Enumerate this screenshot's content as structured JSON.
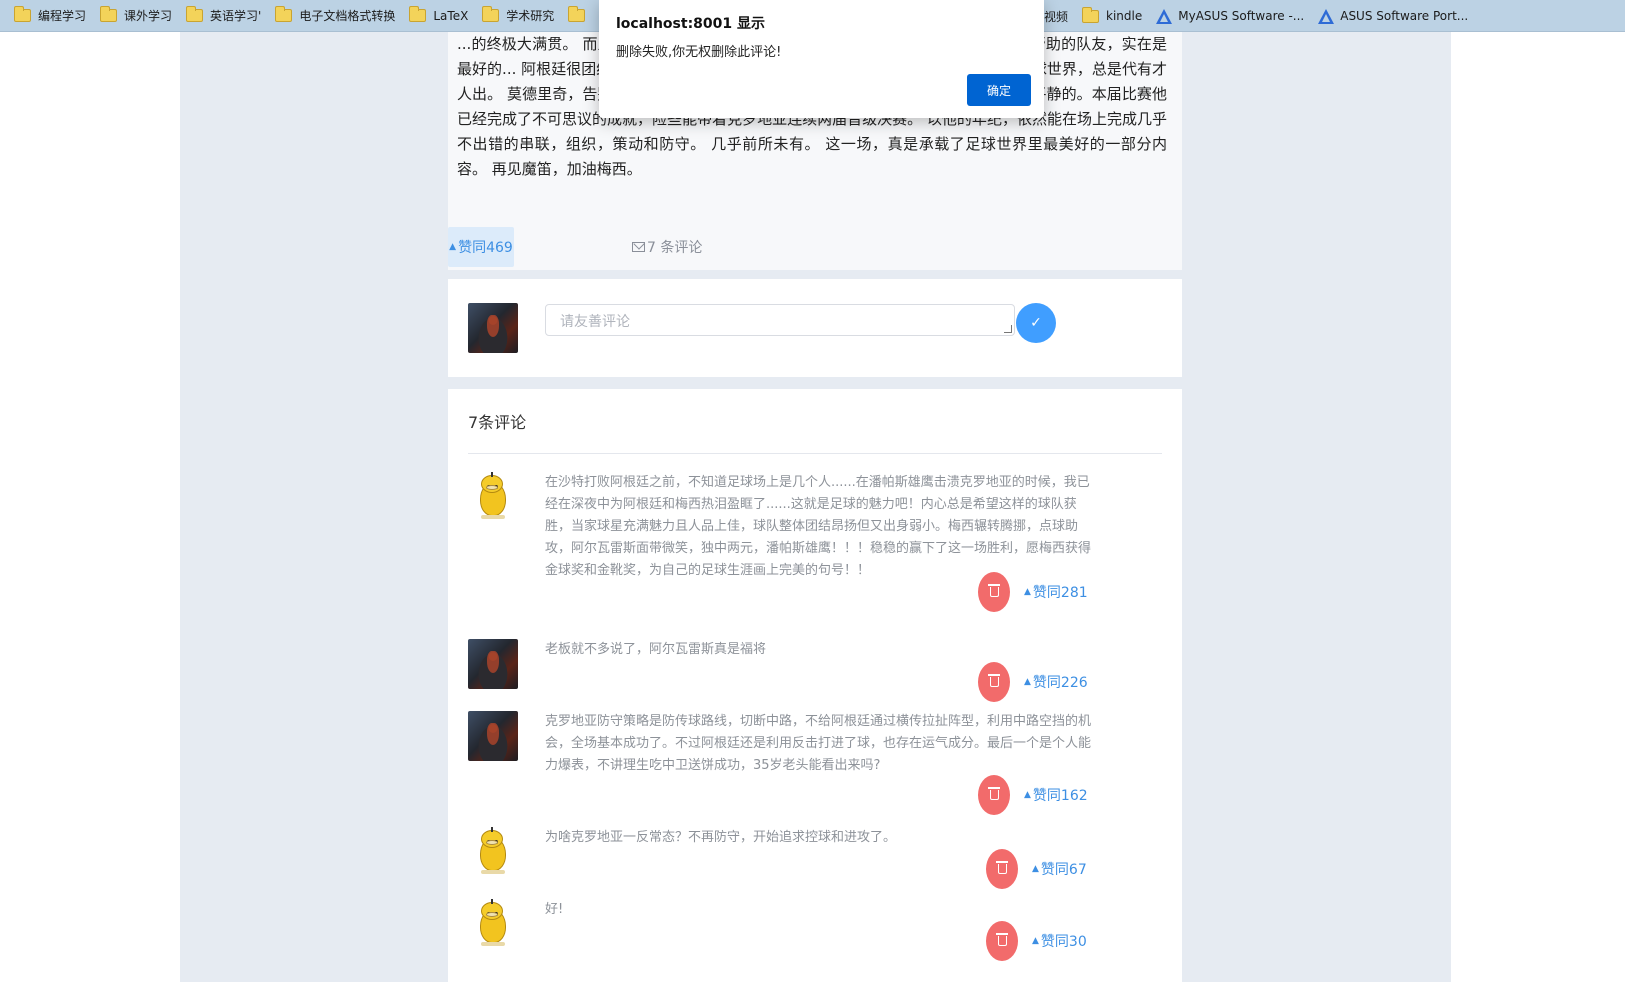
{
  "bookmarks": {
    "left": [
      "编程学习",
      "课外学习",
      "英语学习'",
      "电子文档格式转换",
      "LaTeX",
      "学术研究",
      ""
    ],
    "right": [
      {
        "label": "视频",
        "icon": "folder-icon"
      },
      {
        "label": "kindle",
        "icon": "folder-icon"
      },
      {
        "label": "MyASUS Software -...",
        "icon": "asus-icon"
      },
      {
        "label": "ASUS Software Port...",
        "icon": "asus-icon"
      }
    ]
  },
  "dialog": {
    "title": "localhost:8001 显示",
    "message": "删除失败,你无权删除此评论!",
    "ok_label": "确定"
  },
  "article": {
    "text": "...的终极大满贯。 而且这一场，无论是活力还是能力，对梅西而言都显得..., 提供最多帮助的队友，实在是最好的... 阿根廷很团结，都希望能和梅西一起夺得冠军，并不是应付媒体的套话。 - 足球世界，总是代有才人出。 莫德里奇，告别了世界杯（还有三四名）。 即便最后离开的时候，他也依然还是平静的。本届比赛他已经完成了不可思议的成就，险些能带着克罗地亚连续两届晋级决赛。 以他的年纪，依然能在场上完成几乎不出错的串联，组织，策动和防守。 几乎前所未有。 这一场，真是承载了足球世界里最美好的一部分内容。 再见魔笛，加油梅西。",
    "vote_label": "赞同469",
    "comment_link_label": "7 条评论"
  },
  "composer": {
    "placeholder": "请友善评论"
  },
  "comments": {
    "title": "7条评论",
    "items": [
      {
        "avatar": "duck",
        "text": "在沙特打败阿根廷之前，不知道足球场上是几个人......在潘帕斯雄鹰击溃克罗地亚的时候，我已经在深夜中为阿根廷和梅西热泪盈眶了......这就是足球的魅力吧！内心总是希望这样的球队获胜，当家球星充满魅力且人品上佳，球队整体团结昂扬但又出身弱小。梅西辗转腾挪，点球助攻，阿尔瓦雷斯面带微笑，独中两元，潘帕斯雄鹰！！！稳稳的赢下了这一场胜利，愿梅西获得金球奖和金靴奖，为自己的足球生涯画上完美的句号！！",
        "likes": "赞同281"
      },
      {
        "avatar": "dark",
        "text": "老板就不多说了，阿尔瓦雷斯真是福将",
        "likes": "赞同226"
      },
      {
        "avatar": "dark",
        "text": "克罗地亚防守策略是防传球路线，切断中路，不给阿根廷通过横传拉扯阵型，利用中路空挡的机会，全场基本成功了。不过阿根廷还是利用反击打进了球，也存在运气成分。最后一个是个人能力爆表，不讲理生吃中卫送饼成功，35岁老头能看出来吗?",
        "likes": "赞同162"
      },
      {
        "avatar": "duck",
        "text": "为啥克罗地亚一反常态？不再防守，开始追求控球和进攻了。",
        "likes": "赞同67"
      },
      {
        "avatar": "duck",
        "text": "好!",
        "likes": "赞同30"
      }
    ]
  }
}
